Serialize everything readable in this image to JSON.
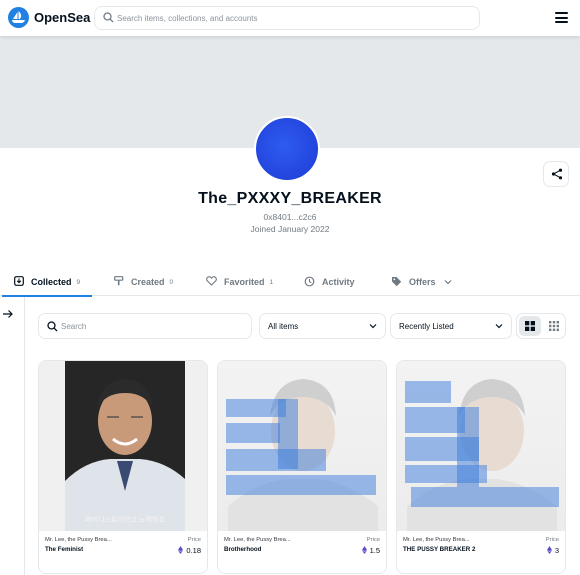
{
  "header": {
    "brand": "OpenSea",
    "search_placeholder": "Search items, collections, and accounts"
  },
  "profile": {
    "name": "The_PXXXY_BREAKER",
    "address": "0x8401...c2c6",
    "joined": "Joined January 2022"
  },
  "tabs": [
    {
      "label": "Collected",
      "count": "9",
      "icon": "collected-icon",
      "active": true
    },
    {
      "label": "Created",
      "count": "0",
      "icon": "brush-icon"
    },
    {
      "label": "Favorited",
      "count": "1",
      "icon": "heart-icon"
    },
    {
      "label": "Activity",
      "count": "",
      "icon": "history-icon"
    },
    {
      "label": "Offers",
      "count": "",
      "icon": "tag-icon"
    }
  ],
  "filters": {
    "search_placeholder": "Search",
    "items_select": "All items",
    "sort_select": "Recently Listed"
  },
  "cards": [
    {
      "collection": "Mr. Lee, the Pussy Brea...",
      "title": "The Feminist",
      "price_label": "Price",
      "price": "0.18",
      "subtitle_text": "페미니스트이려고 노력하죠"
    },
    {
      "collection": "Mr. Lee, the Pussy Brea...",
      "title": "Brotherhood",
      "price_label": "Price",
      "price": "1.5"
    },
    {
      "collection": "Mr. Lee, the Pussy Brea...",
      "title": "THE PUSSY BREAKER 2",
      "price_label": "Price",
      "price": "3"
    }
  ],
  "colors": {
    "accent": "#2081e2",
    "banner": "#e5e8eb",
    "avatar": "#2448e0",
    "eth_purple": "#5b4ec8"
  }
}
